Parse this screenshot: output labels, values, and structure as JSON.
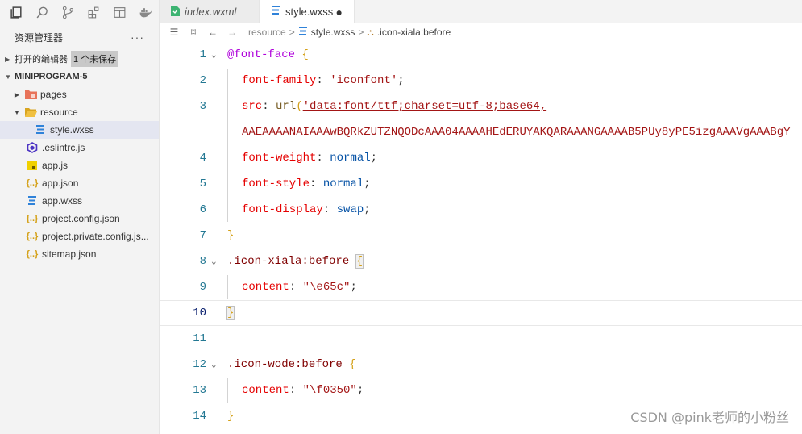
{
  "activity_bar": {
    "icons": [
      "files-icon",
      "search-icon",
      "source-control-icon",
      "extensions-icon",
      "layout-icon",
      "docker-icon"
    ]
  },
  "explorer": {
    "title": "资源管理器",
    "more": "···",
    "open_editors": {
      "label": "打开的编辑器",
      "badge": "1 个未保存"
    },
    "project": {
      "label": "MINIPROGRAM-5"
    },
    "items": [
      {
        "name": "pages",
        "icon": "folder-icon",
        "icon_color": "#e8735a"
      },
      {
        "name": "resource",
        "icon": "folder-open-icon",
        "icon_color": "#e6b422"
      },
      {
        "name": "style.wxss",
        "icon": "css-icon",
        "icon_color": "#2f82d9"
      },
      {
        "name": ".eslintrc.js",
        "icon": "eslint-icon",
        "icon_color": "#4b32c3"
      },
      {
        "name": "app.js",
        "icon": "js-icon",
        "icon_color": "#e6c200"
      },
      {
        "name": "app.json",
        "icon": "json-icon",
        "icon_color": "#d4a017"
      },
      {
        "name": "app.wxss",
        "icon": "css-icon",
        "icon_color": "#2f82d9"
      },
      {
        "name": "project.config.json",
        "icon": "json-icon",
        "icon_color": "#d4a017"
      },
      {
        "name": "project.private.config.js...",
        "icon": "json-icon",
        "icon_color": "#d4a017"
      },
      {
        "name": "sitemap.json",
        "icon": "json-icon",
        "icon_color": "#d4a017"
      }
    ]
  },
  "tabs": [
    {
      "label": "index.wxml",
      "active": false
    },
    {
      "label": "style.wxss",
      "active": true,
      "modified": "●"
    }
  ],
  "breadcrumb": {
    "parts": [
      "resource",
      "style.wxss",
      ".icon-xiala:before"
    ],
    "sep": ">"
  },
  "code": {
    "lines": [
      {
        "n": "1",
        "fold": "⌄"
      },
      {
        "n": "2"
      },
      {
        "n": "3"
      },
      {
        "n": ""
      },
      {
        "n": "4"
      },
      {
        "n": "5"
      },
      {
        "n": "6"
      },
      {
        "n": "7"
      },
      {
        "n": "8",
        "fold": "⌄"
      },
      {
        "n": "9"
      },
      {
        "n": "10"
      },
      {
        "n": "11"
      },
      {
        "n": "12",
        "fold": "⌄"
      },
      {
        "n": "13"
      },
      {
        "n": "14"
      }
    ],
    "t": {
      "at": "@font-face",
      "open": "{",
      "close": "}",
      "p_family": "font-family",
      "v_family": "'iconfont'",
      "p_src": "src",
      "url": "url",
      "lparen": "(",
      "src_1": "'data:font/ttf;charset=utf-8;base64,",
      "src_2": "AAEAAAANAIAAAwBQRkZUTZNQODcAAA04AAAAHEdERUYAKQARAAANGAAAAB5PUy8yPE5izgAAAVgAAABgY",
      "p_weight": "font-weight",
      "v_weight": "normal",
      "p_style": "font-style",
      "v_style": "normal",
      "p_display": "font-display",
      "v_display": "swap",
      "sel_xiala_cls": ".icon-xiala",
      "sel_xiala_ps": ":before",
      "p_content": "content",
      "v_content_1": "\"\\e65c\"",
      "sel_wode_cls": ".icon-wode",
      "sel_wode_ps": ":before",
      "v_content_2": "\"\\f0350\"",
      "colon": ":",
      "semi": ";"
    }
  },
  "watermark": "CSDN @pink老师的小粉丝"
}
